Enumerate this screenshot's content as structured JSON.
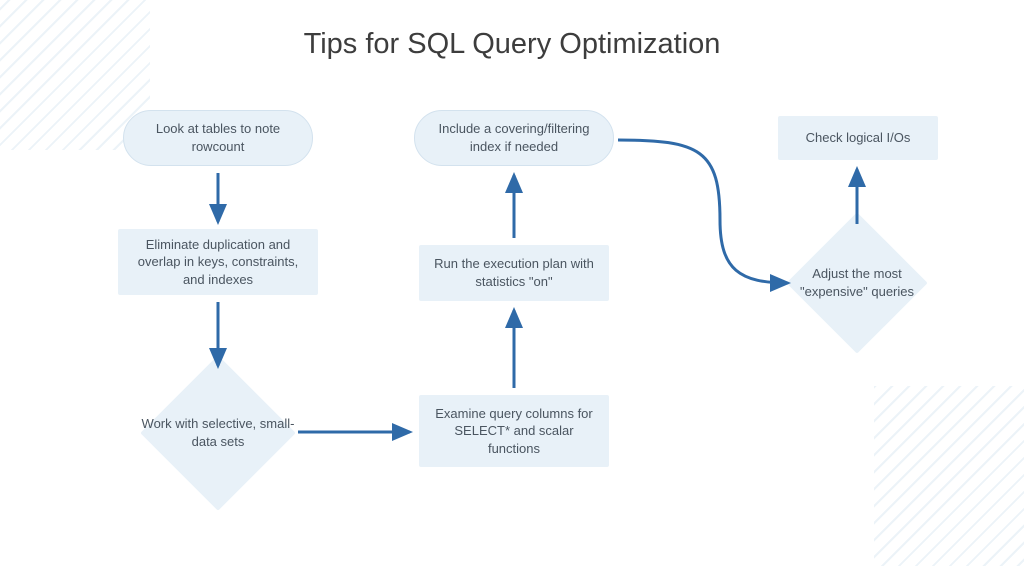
{
  "title": "Tips for SQL Query Optimization",
  "nodes": {
    "n1": "Look at tables to note rowcount",
    "n2": "Eliminate duplication and overlap in keys, constraints, and indexes",
    "n3": "Work with selective, small-data sets",
    "n4": "Examine query columns for SELECT* and scalar functions",
    "n5": "Run the execution plan with statistics \"on\"",
    "n6": "Include a covering/filtering index if needed",
    "n7": "Adjust the most \"expensive\" queries",
    "n8": "Check logical I/Os"
  },
  "colors": {
    "node_fill": "#e8f1f8",
    "text": "#4a5560",
    "arrow": "#2f6aa8"
  }
}
